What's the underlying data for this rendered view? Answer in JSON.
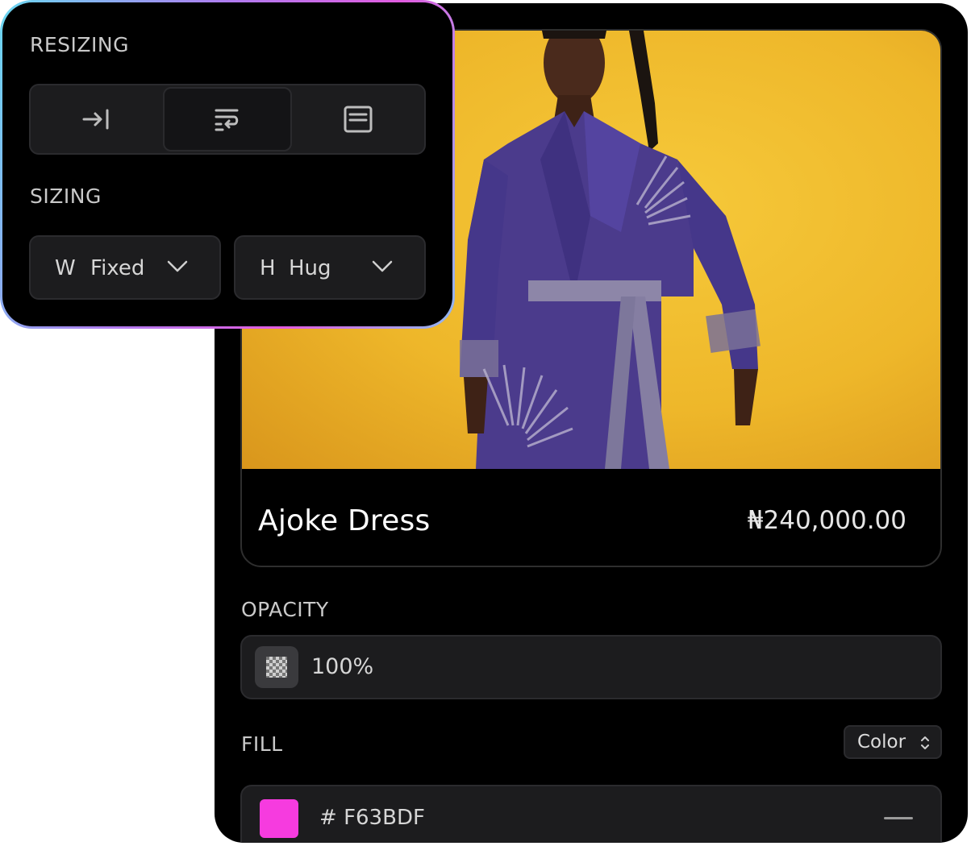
{
  "product": {
    "name": "Ajoke Dress",
    "price": "₦240,000.00"
  },
  "opacity": {
    "label": "OPACITY",
    "value": "100%"
  },
  "fill": {
    "label": "FILL",
    "type_label": "Color",
    "hex_prefix": "#",
    "hex": "F63BDF",
    "swatch_color": "#F63BDF"
  },
  "resizing": {
    "label": "RESIZING",
    "options": [
      {
        "icon": "fixed-width-icon",
        "active": false
      },
      {
        "icon": "wrap-text-icon",
        "active": true
      },
      {
        "icon": "fixed-box-icon",
        "active": false
      }
    ]
  },
  "sizing": {
    "label": "SIZING",
    "width": {
      "axis": "W",
      "mode": "Fixed"
    },
    "height": {
      "axis": "H",
      "mode": "Hug"
    }
  },
  "colors": {
    "accent_gradient_start": "#6ad8f0",
    "accent_gradient_mid": "#e15ce0",
    "panel_bg": "#000000",
    "field_bg": "#1c1c1e"
  }
}
